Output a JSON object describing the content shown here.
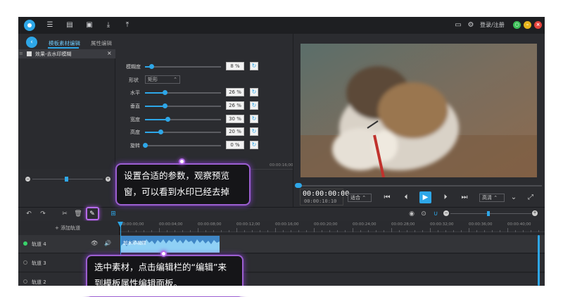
{
  "topbar": {
    "login_label": "登录/注册",
    "icons": [
      "menu-icon",
      "file-icon",
      "save-icon",
      "import-icon",
      "export-icon",
      "chat-icon",
      "gear-icon"
    ]
  },
  "panel": {
    "tabs": [
      {
        "label": "模板素材编辑",
        "active": true
      },
      {
        "label": "属性编辑",
        "active": false
      }
    ],
    "list_item": "效果-去水印模糊",
    "properties": {
      "blur": {
        "label": "模糊度",
        "value": "8 %",
        "level": 0.08
      },
      "shape": {
        "label": "形状",
        "value": "矩形"
      },
      "horizontal": {
        "label": "水平",
        "value": "26 %",
        "level": 0.26
      },
      "vertical": {
        "label": "垂直",
        "value": "26 %",
        "level": 0.26
      },
      "width": {
        "label": "宽度",
        "value": "30 %",
        "level": 0.3
      },
      "height": {
        "label": "高度",
        "value": "20 %",
        "level": 0.2
      },
      "rotate": {
        "label": "旋转",
        "value": "0 %",
        "level": 0.0
      }
    },
    "time_label": "00:00:16;00"
  },
  "preview": {
    "timecode": "00:00:00:00",
    "duration": "00:00:10:10",
    "fit_label": "适合",
    "quality_label": "高清"
  },
  "timeline": {
    "add_track_label": "+ 添加轨道",
    "ruler": [
      "00:00:00;00",
      "00:00:04;00",
      "00:00:08;00",
      "00:00:12;00",
      "00:00:16;00",
      "00:00:20;00",
      "00:00:24;00",
      "00:00:28;00",
      "00:00:32;00",
      "00:00:36;00",
      "00:00:40;00"
    ],
    "tracks": [
      "轨道 4",
      "轨道 3",
      "轨道 2"
    ],
    "clip_label": "加水印视频"
  },
  "callouts": {
    "first": "设置合适的参数，观察预览窗，可以看到水印已经去掉",
    "second": "选中素材，点击编辑栏的“编辑”来到模板属性编辑面板。"
  },
  "colors": {
    "accent": "#2ea7e8",
    "highlight": "#b56bea",
    "bg": "#26272b"
  }
}
